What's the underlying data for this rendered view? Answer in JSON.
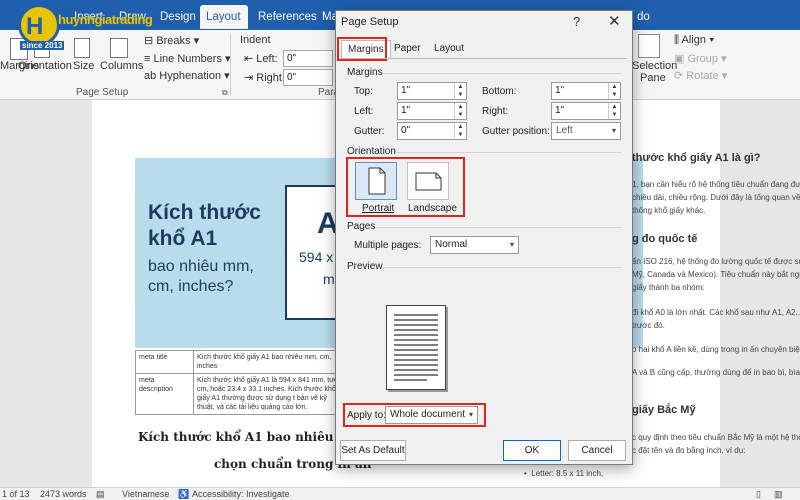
{
  "logo": {
    "brand": "huynhgiatrading",
    "since": "since 2013"
  },
  "ribbon": {
    "tabs": [
      "Insert",
      "Draw",
      "Design",
      "Layout",
      "References",
      "Ma"
    ],
    "right_tab": "do",
    "margins_label": "Margins",
    "orientation_label": "Orientation",
    "size_label": "Size",
    "columns_label": "Columns",
    "breaks_label": "Breaks",
    "line_numbers_label": "Line Numbers",
    "hyphenation_label": "Hyphenation",
    "page_setup_group": "Page Setup",
    "indent_label": "Indent",
    "left_label": "Left:",
    "left_value": "0\"",
    "right_label": "Right:",
    "right_value": "0\"",
    "para_group": "Para",
    "selection_pane_1": "Selection",
    "selection_pane_2": "Pane",
    "align_label": "Align",
    "group_label": "Group",
    "rotate_label": "Rotate"
  },
  "document": {
    "banner_title": "Kích thước khổ A1",
    "banner_sub": "bao nhiêu mm, cm, inches?",
    "banner_big": "A",
    "banner_num": "594 x",
    "banner_m": "m",
    "meta_rows": [
      {
        "k": "meta title",
        "v": "Kích thước khổ giấy A1 bao nhiêu mm, cm, inches"
      },
      {
        "k": "meta description",
        "v": "Kích thước khổ giấy A1 là 594 x 841 mm, tươ cm, hoặc 23.4 x 33.1 inches. Kích thước khổ giấy A1 thường được sử dụng t bản vẽ kỹ thuật, và các tài liệu quảng cáo lớn."
      }
    ],
    "heading_1": "Kích thước khổ A1 bao nhiêu mm, cm",
    "heading_2": "chọn chuẩn trong in ấn",
    "right_heading_1": "thước khổ giấy A1 là gì?",
    "right_lines_1": [
      "1, bạn cần hiểu rõ hệ thống tiêu chuẩn đang được sử",
      "chiều dài, chiều rộng. Dưới đây là tổng quan về tiêu",
      "thống khổ giấy khác."
    ],
    "right_heading_2": "g đo quốc tế",
    "right_lines_2": [
      "ẩn ISO 216, hệ thống đo lường quốc tế được sử dụng",
      "Mỹ, Canada và Mexico). Tiêu chuẩn này bắt nguồn từ",
      "giấy thành ba nhóm:"
    ],
    "right_line_3": "đi khổ A0 là lớn nhất. Các khổ sau như A1, A2... đều",
    "right_line_3b": "trước đó.",
    "right_line_4": "o hai khổ A liền kề, dùng trong in ấn chuyên biệt.",
    "right_line_5": "A và B cũng cấp, thường dùng để in bao bì, bìa, phong",
    "right_heading_3": "giấy Bắc Mỹ",
    "right_lines_6": [
      "c quy định theo tiêu chuẩn Bắc Mỹ là một hệ thống",
      "c đặt tên và đo bằng inch, ví dụ:"
    ],
    "right_bullet": "Letter: 8.5 x 11 inch,"
  },
  "statusbar": {
    "pages": "1 of 13",
    "words": "2473 words",
    "language": "Vietnamese",
    "accessibility": "Accessibility: Investigate"
  },
  "dialog": {
    "title": "Page Setup",
    "help": "?",
    "close": "✕",
    "tabs": [
      "Margins",
      "Paper",
      "Layout"
    ],
    "margins_section": "Margins",
    "top_label": "Top:",
    "top_value": "1\"",
    "bottom_label": "Bottom:",
    "bottom_value": "1\"",
    "left_label": "Left:",
    "left_value": "1\"",
    "right_label": "Right:",
    "right_value": "1\"",
    "gutter_label": "Gutter:",
    "gutter_value": "0\"",
    "gutter_position_label": "Gutter position:",
    "gutter_position_value": "Left",
    "orientation_section": "Orientation",
    "portrait_label": "Portrait",
    "landscape_label": "Landscape",
    "pages_section": "Pages",
    "multiple_pages_label": "Multiple pages:",
    "multiple_pages_value": "Normal",
    "preview_section": "Preview",
    "apply_to_label": "Apply to:",
    "apply_to_value": "Whole document",
    "set_default_label": "Set As Default",
    "ok_label": "OK",
    "cancel_label": "Cancel"
  },
  "colors": {
    "accent": "#1f5fae",
    "highlight": "#e1241c",
    "logo": "#e8c300"
  }
}
